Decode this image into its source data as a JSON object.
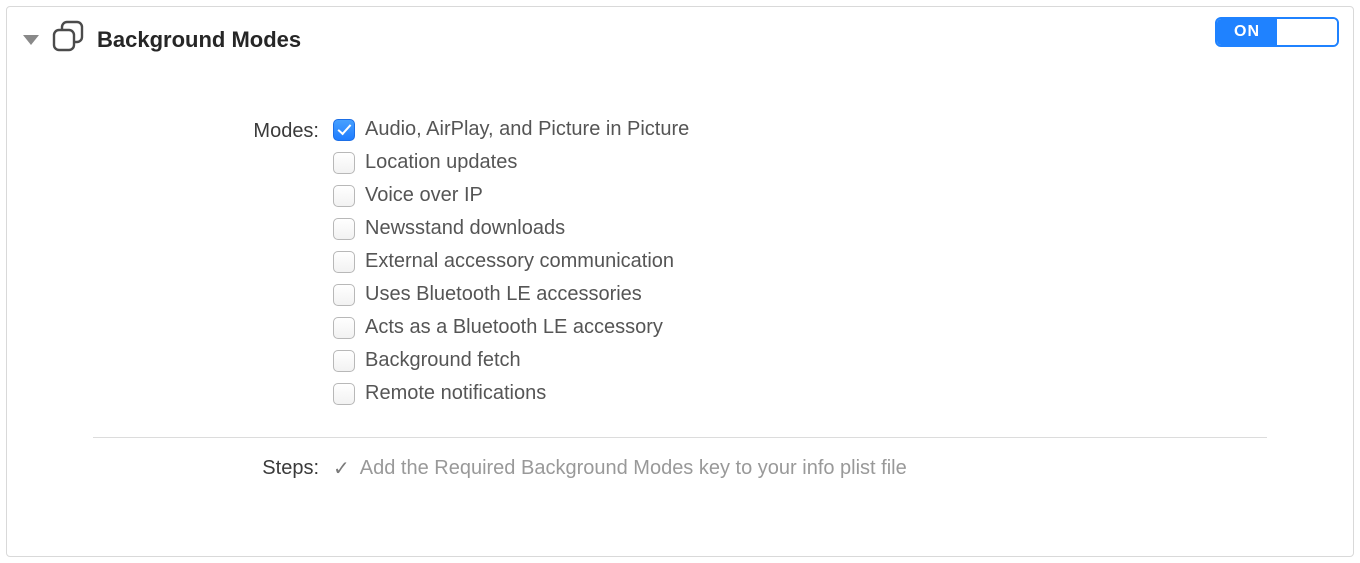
{
  "panel": {
    "title": "Background Modes",
    "toggle": {
      "state": "ON"
    }
  },
  "modes": {
    "label": "Modes:",
    "items": [
      {
        "label": "Audio, AirPlay, and Picture in Picture",
        "checked": true
      },
      {
        "label": "Location updates",
        "checked": false
      },
      {
        "label": "Voice over IP",
        "checked": false
      },
      {
        "label": "Newsstand downloads",
        "checked": false
      },
      {
        "label": "External accessory communication",
        "checked": false
      },
      {
        "label": "Uses Bluetooth LE accessories",
        "checked": false
      },
      {
        "label": "Acts as a Bluetooth LE accessory",
        "checked": false
      },
      {
        "label": "Background fetch",
        "checked": false
      },
      {
        "label": "Remote notifications",
        "checked": false
      }
    ]
  },
  "steps": {
    "label": "Steps:",
    "items": [
      {
        "done": true,
        "text": "Add the Required Background Modes key to your info plist file"
      }
    ]
  }
}
